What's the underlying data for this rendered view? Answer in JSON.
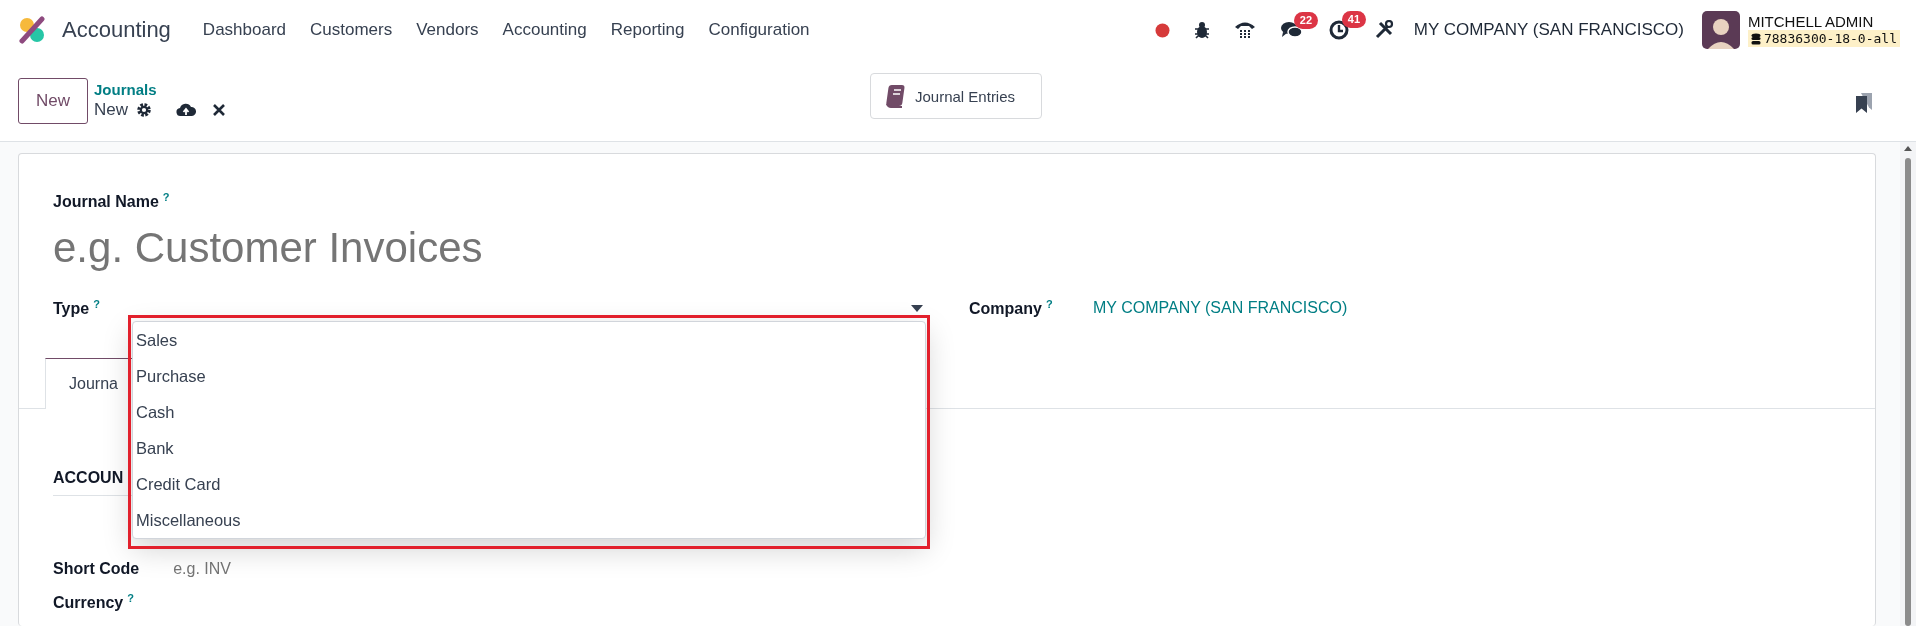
{
  "navbar": {
    "app_name": "Accounting",
    "menu": [
      {
        "label": "Dashboard"
      },
      {
        "label": "Customers"
      },
      {
        "label": "Vendors"
      },
      {
        "label": "Accounting"
      },
      {
        "label": "Reporting"
      },
      {
        "label": "Configuration"
      }
    ],
    "systray": {
      "chat_count": "22",
      "activity_count": "41",
      "company": "MY COMPANY (SAN FRANCISCO)",
      "user": "MITCHELL ADMIN",
      "database": "78836300-18-0-all"
    }
  },
  "control_panel": {
    "new_button": "New",
    "breadcrumb": "Journals",
    "record": "New",
    "smart_button": "Journal Entries"
  },
  "form": {
    "journal_name": {
      "label": "Journal Name",
      "help": "?",
      "placeholder": "e.g. Customer Invoices"
    },
    "type": {
      "label": "Type",
      "help": "?",
      "expanded": true,
      "options": [
        {
          "label": "Sales",
          "selected": false
        },
        {
          "label": "Purchase",
          "selected": false
        },
        {
          "label": "Cash",
          "selected": false
        },
        {
          "label": "Bank",
          "selected": false
        },
        {
          "label": "Credit Card",
          "selected": false
        },
        {
          "label": "Miscellaneous",
          "selected": false
        }
      ]
    },
    "company": {
      "label": "Company",
      "help": "?",
      "value": "MY COMPANY (SAN FRANCISCO)"
    },
    "tabs": [
      {
        "label": "Journa",
        "selected": true
      }
    ],
    "section": "ACCOUN",
    "short_code": {
      "label": "Short Code",
      "placeholder": "e.g. INV"
    },
    "currency": {
      "label": "Currency",
      "help": "?"
    }
  }
}
